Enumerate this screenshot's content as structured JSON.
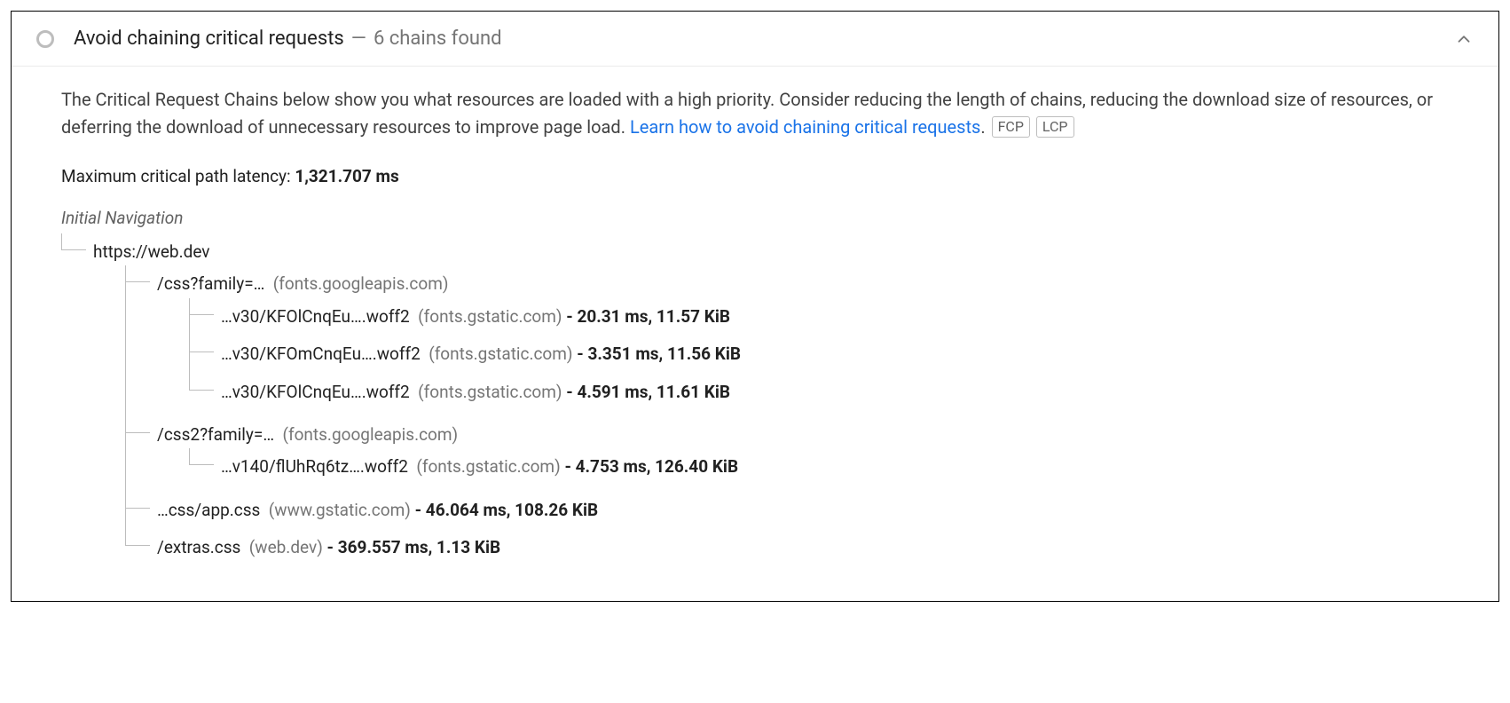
{
  "audit": {
    "title": "Avoid chaining critical requests",
    "separator": "—",
    "summary": "6 chains found",
    "description_pre": "The Critical Request Chains below show you what resources are loaded with a high priority. Consider reducing the length of chains, reducing the download size of resources, or deferring the download of unnecessary resources to improve page load. ",
    "link_text": "Learn how to avoid chaining critical requests",
    "period": ".",
    "badges": [
      "FCP",
      "LCP"
    ],
    "latency_label": "Maximum critical path latency: ",
    "latency_value": "1,321.707 ms",
    "initial_nav_label": "Initial Navigation",
    "tree": [
      {
        "path": "https://web.dev",
        "origin": "",
        "stats": "",
        "children": [
          {
            "path": "/css?family=…",
            "origin": "(fonts.googleapis.com)",
            "stats": "",
            "children": [
              {
                "path": "…v30/KFOlCnqEu….woff2",
                "origin": "(fonts.gstatic.com)",
                "stats": "- 20.31 ms, 11.57 KiB",
                "children": []
              },
              {
                "path": "…v30/KFOmCnqEu….woff2",
                "origin": "(fonts.gstatic.com)",
                "stats": "- 3.351 ms, 11.56 KiB",
                "children": []
              },
              {
                "path": "…v30/KFOlCnqEu….woff2",
                "origin": "(fonts.gstatic.com)",
                "stats": "- 4.591 ms, 11.61 KiB",
                "children": []
              }
            ]
          },
          {
            "path": "/css2?family=…",
            "origin": "(fonts.googleapis.com)",
            "stats": "",
            "children": [
              {
                "path": "…v140/flUhRq6tz….woff2",
                "origin": "(fonts.gstatic.com)",
                "stats": "- 4.753 ms, 126.40 KiB",
                "children": []
              }
            ]
          },
          {
            "path": "…css/app.css",
            "origin": "(www.gstatic.com)",
            "stats": "- 46.064 ms, 108.26 KiB",
            "children": []
          },
          {
            "path": "/extras.css",
            "origin": "(web.dev)",
            "stats": "- 369.557 ms, 1.13 KiB",
            "children": []
          }
        ]
      }
    ]
  }
}
